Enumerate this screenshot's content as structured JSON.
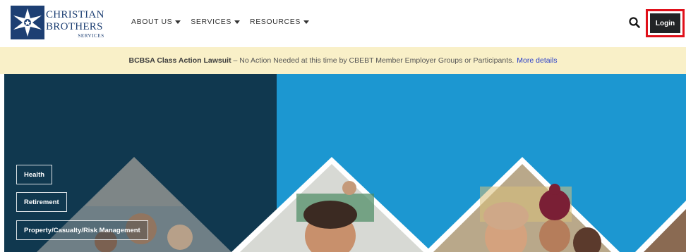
{
  "logo": {
    "line1": "CHRISTIAN",
    "line2": "BROTHERS",
    "line3": "SERVICES"
  },
  "nav": {
    "items": [
      {
        "label": "ABOUT US"
      },
      {
        "label": "SERVICES"
      },
      {
        "label": "RESOURCES"
      }
    ]
  },
  "header": {
    "login_label": "Login"
  },
  "banner": {
    "strong": "BCBSA Class Action Lawsuit",
    "text": " – No Action Needed at this time by CBEBT Member Employer Groups or Participants.",
    "link": "More details"
  },
  "hero": {
    "service_buttons": [
      {
        "label": "Health"
      },
      {
        "label": "Retirement"
      },
      {
        "label": "Property/Casualty/Risk Management"
      }
    ]
  },
  "colors": {
    "brand_navy": "#1d3f73",
    "hero_dark": "#10384f",
    "hero_blue": "#1c97d1",
    "banner_bg": "#f9f0c8",
    "link_blue": "#2a3fc9",
    "highlight_red": "#e0101a",
    "login_bg": "#222426"
  },
  "icons": {
    "logo_mark": "star-cross-logo-icon",
    "search": "search-icon",
    "dropdown": "caret-down-icon"
  }
}
